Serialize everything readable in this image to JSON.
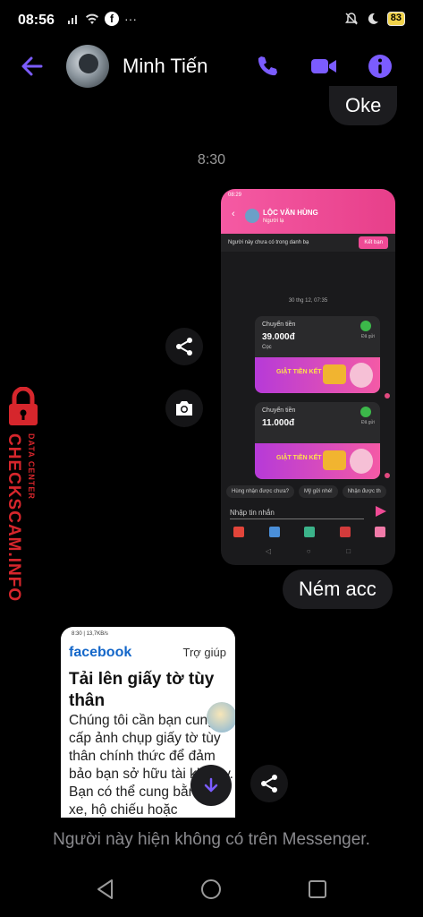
{
  "status_bar": {
    "time": "08:56",
    "battery": "83",
    "more": "···"
  },
  "header": {
    "contact_name": "Minh Tiến",
    "accent_color": "#7b5cff"
  },
  "messages": {
    "oke": "Oke",
    "timestamp": "8:30",
    "nem_acc": "Ném acc",
    "notice": "Người này hiện không có trên Messenger."
  },
  "screenshot_1": {
    "status_time": "08:29",
    "name": "LỘC VĂN HÙNG",
    "subtitle": "Người lạ",
    "notice": "Người này chưa có trong danh bạ",
    "add_friend": "Kết bạn",
    "date": "30 thg 12, 07:35",
    "transfer_1": {
      "title": "Chuyển tiền",
      "amount": "39.000đ",
      "status": "Đã gửi",
      "note": "Cọc",
      "banner": "GIẬT TIỀN KẾT NĂM"
    },
    "transfer_2": {
      "title": "Chuyển tiền",
      "amount": "11.000đ",
      "status": "Đã gửi",
      "banner": "GIẬT TIỀN KẾT NĂM"
    },
    "chips": [
      "Hùng nhận được chưa?",
      "Mỹ gửi nhé!",
      "Nhận được th"
    ],
    "input_placeholder": "Nhập tin nhắn"
  },
  "screenshot_2": {
    "status_time": "8:30 | 13,7KB/s",
    "logo": "facebook",
    "help": "Trợ giúp",
    "title": "Tải lên giấy tờ tùy thân",
    "body": "Chúng tôi cần bạn cung cấp ảnh chụp giấy tờ tùy thân chính thức để đảm bảo bạn sở hữu tài kh này. Bạn có thể cung bằng lái xe, hộ chiếu hoặc"
  },
  "watermark": {
    "text": "CHECKSCAM.INFO",
    "sub": "DATA CENTER",
    "color": "#d6262c"
  }
}
